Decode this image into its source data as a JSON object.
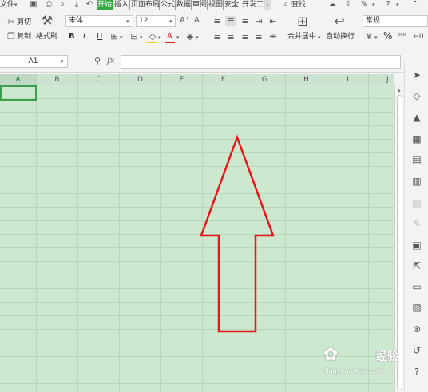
{
  "menu": {
    "file": "文件",
    "tabs": [
      "开始",
      "插入",
      "页面布局",
      "公式",
      "数据",
      "审阅",
      "视图",
      "安全",
      "开发工"
    ],
    "active_tab": "开始",
    "search": "查找"
  },
  "ribbon": {
    "cut": "剪切",
    "copy": "复制",
    "format_painter": "格式刷",
    "font_name": "宋体",
    "font_size": "12",
    "bold": "B",
    "italic": "I",
    "underline": "U",
    "font_color_letter": "A",
    "merge_center": "合并居中",
    "wrap_text": "自动换行",
    "number_format": "常规",
    "percent": "%"
  },
  "formula_bar": {
    "name_box": "A1",
    "fx": "fx",
    "formula": ""
  },
  "grid": {
    "columns": [
      "A",
      "B",
      "C",
      "D",
      "E",
      "F",
      "G",
      "H",
      "I",
      "J"
    ],
    "selected_column": "A"
  },
  "watermark": {
    "text": "经验",
    "url": "jingyan.baidu.com"
  },
  "colors": {
    "accent": "#36a842",
    "sheet_bg": "#cce8cf",
    "arrow": "#e8161b"
  }
}
